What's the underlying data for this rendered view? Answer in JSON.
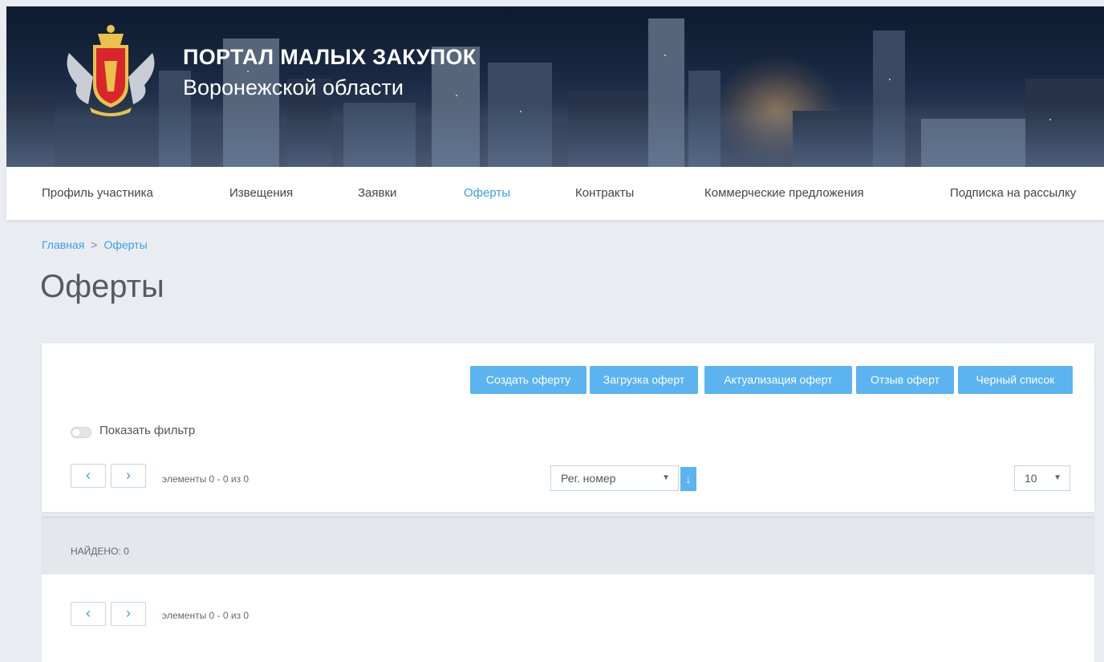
{
  "header": {
    "title": "ПОРТАЛ МАЛЫХ ЗАКУПОК",
    "subtitle": "Воронежской области"
  },
  "nav": {
    "items": [
      {
        "label": "Профиль участника"
      },
      {
        "label": "Извещения"
      },
      {
        "label": "Заявки"
      },
      {
        "label": "Оферты"
      },
      {
        "label": "Контракты"
      },
      {
        "label": "Коммерческие предложения"
      },
      {
        "label": "Подписка на рассылку"
      }
    ],
    "active": "Оферты"
  },
  "breadcrumb": {
    "home": "Главная",
    "separator": ">",
    "current": "Оферты"
  },
  "page_title": "Оферты",
  "actions": {
    "create": "Создать оферту",
    "upload": "Загрузка оферт",
    "actualize": "Актуализация оферт",
    "recall": "Отзыв оферт",
    "blacklist": "Черный список"
  },
  "filter": {
    "toggle_label": "Показать фильтр",
    "enabled": false
  },
  "pager": {
    "prev_icon": "chevron-left-icon",
    "next_icon": "chevron-right-icon",
    "prev_glyph": "‹",
    "next_glyph": "›",
    "range_text": "элементы 0 - 0 из 0"
  },
  "sort": {
    "field": "Рег. номер",
    "direction_glyph": "↓"
  },
  "page_size": "10",
  "found": "НАЙДЕНО: 0",
  "colors": {
    "accent": "#3a9fe8",
    "button": "#5bb3f0",
    "background": "#e9edf2"
  }
}
